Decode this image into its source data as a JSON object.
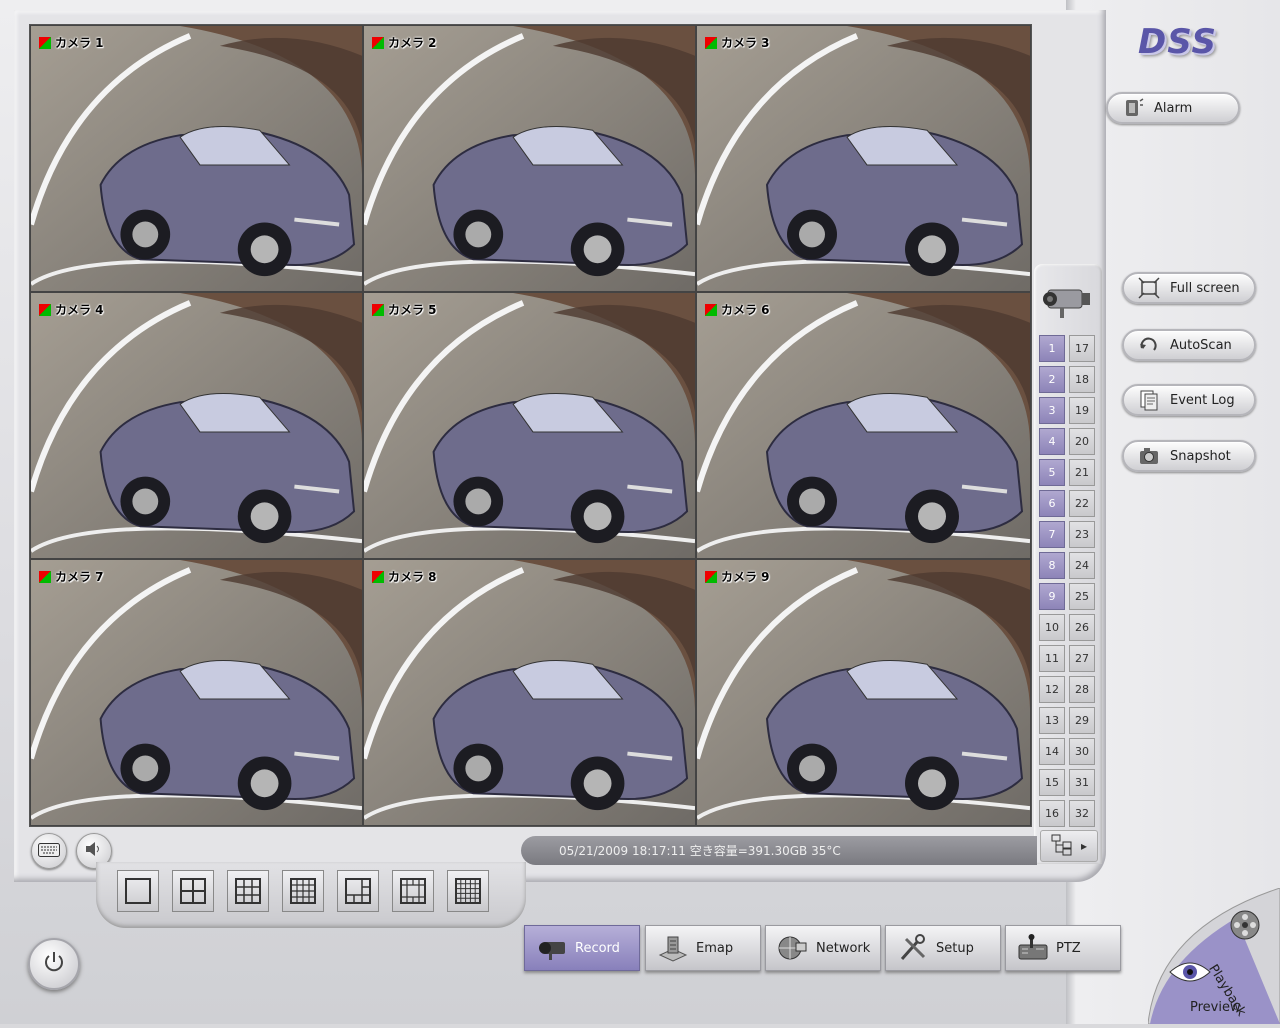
{
  "app": {
    "logo_text": "DSS"
  },
  "cameras": [
    {
      "label": "カメラ 1"
    },
    {
      "label": "カメラ 2"
    },
    {
      "label": "カメラ 3"
    },
    {
      "label": "カメラ 4"
    },
    {
      "label": "カメラ 5"
    },
    {
      "label": "カメラ 6"
    },
    {
      "label": "カメラ 7"
    },
    {
      "label": "カメラ 8"
    },
    {
      "label": "カメラ 9"
    }
  ],
  "right_buttons": {
    "alarm": "Alarm",
    "full_screen": "Full screen",
    "autoscan": "AutoScan",
    "event_log": "Event Log",
    "snapshot": "Snapshot"
  },
  "channels": {
    "left": [
      "1",
      "2",
      "3",
      "4",
      "5",
      "6",
      "7",
      "8",
      "9",
      "10",
      "11",
      "12",
      "13",
      "14",
      "15",
      "16"
    ],
    "right": [
      "17",
      "18",
      "19",
      "20",
      "21",
      "22",
      "23",
      "24",
      "25",
      "26",
      "27",
      "28",
      "29",
      "30",
      "31",
      "32"
    ],
    "active_count": 9
  },
  "status_bar": {
    "text": "05/21/2009 18:17:11  空き容量=391.30GB 35°C"
  },
  "tabs": {
    "record": "Record",
    "emap": "Emap",
    "network": "Network",
    "setup": "Setup",
    "ptz": "PTZ"
  },
  "corner": {
    "preview": "Preview",
    "playback": "Playback"
  },
  "colors": {
    "accent": "#8d84b8",
    "logo": "#5a56a8"
  }
}
